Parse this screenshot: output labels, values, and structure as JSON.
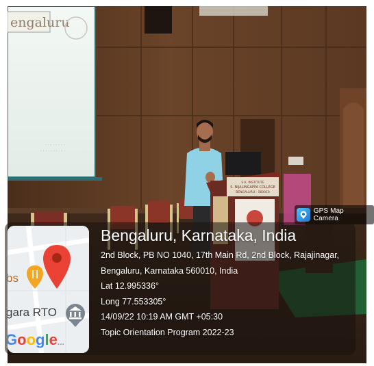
{
  "projector_screen": {
    "visible_text": "engaluru"
  },
  "podium_sign": {
    "line1": "S.K. INSTITUTE",
    "line2": "S. NIJALINGAPPA COLLEGE",
    "line3": "BENGALURU - 560010"
  },
  "gps_badge": {
    "label": "GPS Map Camera",
    "icon": "map-pin-camera-icon"
  },
  "map_thumbnail": {
    "label_left": "bs",
    "label_rto": "gara RTO",
    "brand": "Google",
    "icons": [
      "restaurant-pin-icon",
      "location-pin-icon",
      "government-building-icon"
    ]
  },
  "location": {
    "title": "Bengaluru, Karnataka, India",
    "address_line1": "2nd Block, PB NO 1040, 17th Main Rd, 2nd Block, Rajajinagar,",
    "address_line2": "Bengaluru, Karnataka 560010, India",
    "lat": "Lat 12.995336°",
    "long": "Long 77.553305°",
    "datetime": "14/09/22 10:19 AM GMT +05:30",
    "note": "Topic Orientation Program 2022-23"
  },
  "colors": {
    "pin_red": "#ea4335",
    "pin_orange": "#f4a522",
    "google_blue": "#4285f4",
    "google_red": "#ea4335",
    "google_yellow": "#fbbc05",
    "google_green": "#34a853"
  }
}
